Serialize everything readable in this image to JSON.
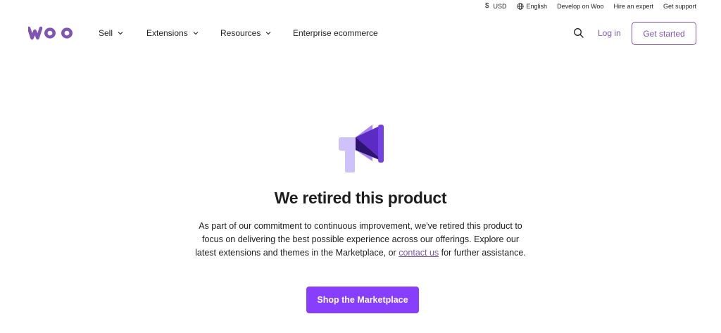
{
  "utility_bar": {
    "currency": "USD",
    "currency_symbol": "$",
    "language": "English",
    "develop": "Develop on Woo",
    "hire": "Hire an expert",
    "support": "Get support"
  },
  "brand": {
    "logo_text": "woo",
    "color": "#7f54b3"
  },
  "nav": {
    "items": [
      {
        "label": "Sell",
        "has_dropdown": true
      },
      {
        "label": "Extensions",
        "has_dropdown": true
      },
      {
        "label": "Resources",
        "has_dropdown": true
      },
      {
        "label": "Enterprise ecommerce",
        "has_dropdown": false
      }
    ],
    "search_icon": "search-icon",
    "login": "Log in",
    "get_started": "Get started"
  },
  "main": {
    "icon": "megaphone-icon",
    "title": "We retired this product",
    "body_before_link": "As part of our commitment to continuous improvement, we've retired this product to focus on delivering the best possible experience across our offerings. Explore our latest extensions and themes in the Marketplace, or ",
    "link_text": "contact us",
    "body_after_link": " for further assistance.",
    "cta": "Shop the Marketplace"
  },
  "colors": {
    "accent": "#7f54b3",
    "cta_bg": "#873eff",
    "icon_light": "#cfc1f9",
    "icon_dark": "#5b2bc4"
  }
}
